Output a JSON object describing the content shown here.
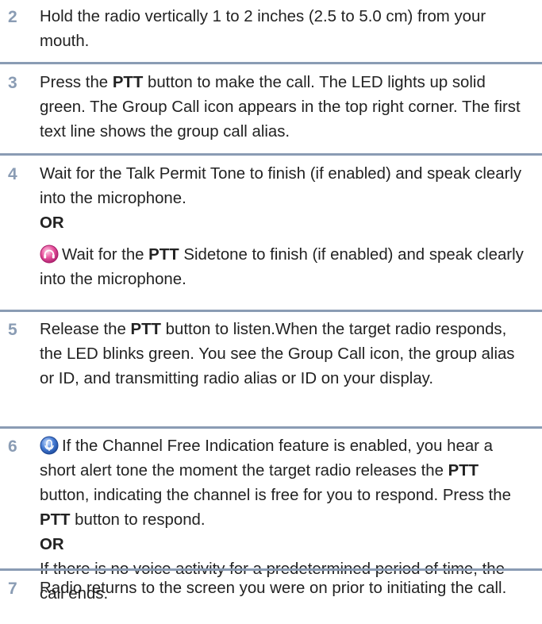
{
  "steps": [
    {
      "number": "2",
      "text": "Hold the radio vertically 1 to 2 inches (2.5 to 5.0 cm) from your mouth."
    },
    {
      "number": "3",
      "pre": "Press the ",
      "bold1": "PTT",
      "post": " button to make the call. The LED lights up solid green. The Group Call icon appears in the top right corner. The first text line shows the group call alias."
    },
    {
      "number": "4",
      "line1": "Wait for the Talk Permit Tone to finish (if enabled) and speak clearly into the microphone.",
      "or": "OR",
      "alt_pre": "Wait for the ",
      "alt_bold": "PTT",
      "alt_post": " Sidetone to finish (if enabled) and speak clearly into the microphone.",
      "alt_icon": "pink-headset-icon"
    },
    {
      "number": "5",
      "pre": "Release the ",
      "bold1": "PTT",
      "post": " button to listen.When the target radio responds, the LED blinks green. You see the Group Call icon, the group alias or ID, and transmitting radio alias or ID on your display."
    },
    {
      "number": "6",
      "icon": "blue-channel-free-icon",
      "pre": "If the Channel Free Indication feature is enabled, you hear a short alert tone the moment the target radio releases the ",
      "bold1": "PTT",
      "mid": " button, indicating the channel is free for you to respond. Press the ",
      "bold2": "PTT",
      "post": " button to respond.",
      "or": "OR",
      "alt": "If there is no voice activity for a predetermined period of time, the call ends."
    },
    {
      "number": "7",
      "text": "Radio returns to the screen you were on prior to initiating the call."
    }
  ],
  "colors": {
    "step_number": "#8a9cb4",
    "rule": "#8a9cb4",
    "body_text": "#222222"
  }
}
